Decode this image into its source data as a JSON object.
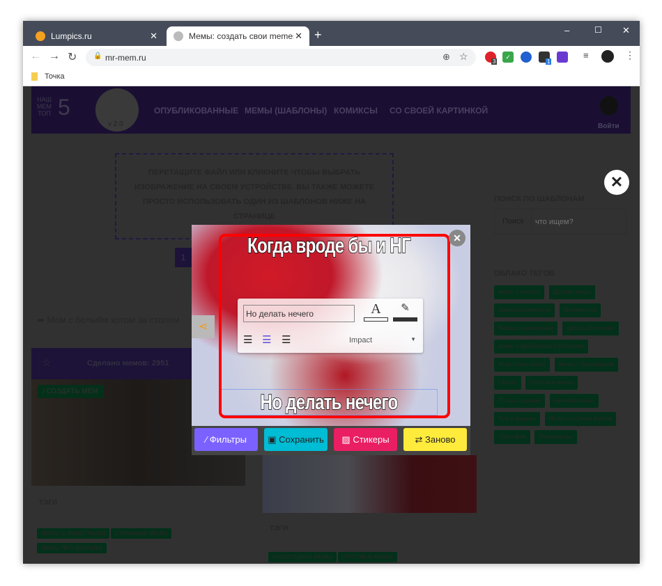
{
  "browser": {
    "tabs": [
      {
        "title": "Lumpics.ru",
        "favicon_color": "#f4a020"
      },
      {
        "title": "Мемы: создать свои memes онл",
        "active": true
      }
    ],
    "new_tab": "+",
    "minimize": "–",
    "maximize": "☐",
    "close": "✕",
    "tab_close": "✕",
    "url": "mr-mem.ru",
    "bookmarks": [
      {
        "label": "Точка"
      }
    ],
    "extension_badges": [
      "3",
      "1"
    ]
  },
  "site": {
    "logo": {
      "line1": "НАШ",
      "line2": "МЕМ",
      "line3": "ТОП",
      "number": "5",
      "version": "v 2.0"
    },
    "nav": [
      "ОПУБЛИКОВАННЫЕ",
      "МЕМЫ (ШАБЛОНЫ)",
      "КОМИКСЫ",
      "СО СВОЕЙ КАРТИНКОЙ"
    ],
    "login": "Войти",
    "dropzone": "ПЕРЕТАЩИТЕ ФАЙЛ ИЛИ КЛИКНИТЕ ЧТОБЫ ВЫБРАТЬ ИЗОБРАЖЕНИЕ НА СВОЕМ УСТРОЙСТВЕ. ВЫ ТАКЖЕ МОЖЕТЕ ПРОСТО ИСПОЛЬЗОВАТЬ ОДИН ИЗ ШАБЛОНОВ НИЖЕ НА СТРАНИЦЕ",
    "page_number": "1",
    "meme_link": "Мем с белыйм котом за столом",
    "card": {
      "count_label": "Сделано мемов: 2951",
      "create_button": "СОЗДАТЬ МЕМ",
      "tags_title": "ТЭГИ",
      "tags": [
        "МЕМЫ С ЖИВОТНЫМИ",
        "СТРАННЫЕ МЕМЫ",
        "МЕМЫ ПРО ДЕВУШЕК"
      ]
    },
    "card2": {
      "tags_title": "ТЭГИ",
      "tags": [
        "НОВОГОДНИЕ МЕМЫ",
        "ГРУСТНЫЕ МЕМЫ"
      ]
    },
    "sidebar": {
      "search_title": "ПОИСК ПО ШАБЛОНАМ",
      "search_button": "Поиск",
      "search_placeholder": "что ищем?",
      "cloud_title": "ОБЛАКО ТЕГОВ",
      "tags": [
        "мемы с негром",
        "Дружко мемы",
        "Сверхспособности",
        "Математика",
        "Мемы с животными",
        "Цитаты Стэтхэма",
        "мемы с Джейсоном Стэтхэмом",
        "Властелин колец",
        "Мемы с Боромиром",
        "Грусть",
        "Грустные мемы",
        "Птица с руками",
        "мультфильмы",
        "Том и джерри",
        "Мемы со Спанч Бобом",
        "Губка Боб",
        "Пришельцы"
      ]
    }
  },
  "editor": {
    "top_text": "Когда вроде бы и НГ",
    "bottom_text": "Но делать нечего",
    "text_input_value": "Но делать нечего",
    "font": "Impact",
    "buttons": [
      {
        "label": "Фильтры",
        "color": "#7b61ff"
      },
      {
        "label": "Сохранить",
        "color": "#00bcd4"
      },
      {
        "label": "Стикеры",
        "color": "#e91e63"
      },
      {
        "label": "Заново",
        "color": "#ffeb3b"
      }
    ],
    "close": "✕",
    "overlay_close": "✕",
    "highlight_color": "#ff0000"
  }
}
